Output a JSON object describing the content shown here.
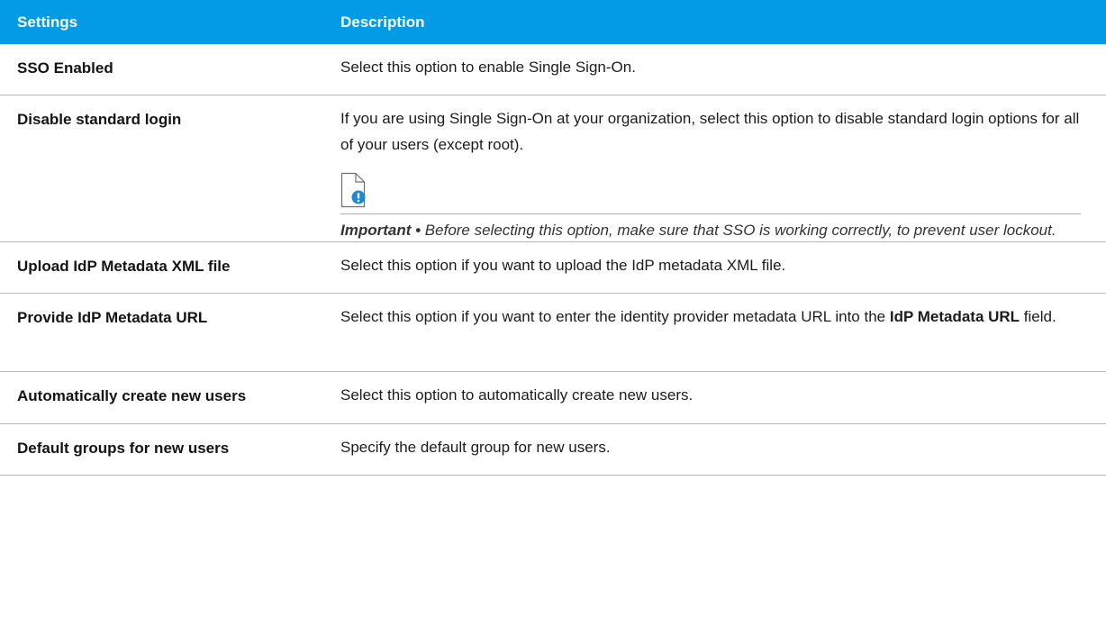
{
  "table": {
    "header": {
      "settings": "Settings",
      "description": "Description"
    },
    "rows": [
      {
        "setting": "SSO Enabled",
        "description": "Select this option to enable Single Sign-On."
      },
      {
        "setting": "Disable standard login",
        "description": "If you are using Single Sign-On at your organization, select this option to disable standard login options for all of your users (except root).",
        "note": {
          "icon": "important-note-icon",
          "label": "Important •",
          "text": "Before selecting this option, make sure that SSO is working correctly, to prevent user lockout."
        }
      },
      {
        "setting": "Upload IdP Metadata XML file",
        "description": "Select this option if you want to upload the IdP metadata XML file."
      },
      {
        "setting": "Provide IdP Metadata URL",
        "description_before": "Select this option if you want to enter the identity provider metadata URL into the",
        "description_strong": "IdP Metadata URL",
        "description_after": "field."
      },
      {
        "setting": "Automatically create new users",
        "description": "Select this option to automatically create new users."
      },
      {
        "setting": "Default groups for new users",
        "description": "Specify the default group for new users."
      }
    ]
  },
  "colors": {
    "header_bg": "#039be5",
    "header_text": "#ffffff",
    "icon_accent": "#1e88d2",
    "divider": "#b8b8b8"
  }
}
